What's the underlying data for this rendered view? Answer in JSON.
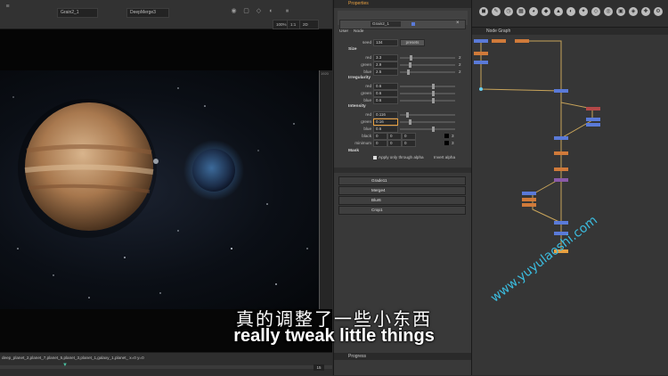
{
  "viewer": {
    "node_field": "Grain2_1",
    "b_field": "DeepMerge3",
    "zoom": "100%",
    "ratio": "1:1",
    "mode": "2D",
    "resolution_tag": "1920",
    "status_text": "deep_planet_2,planet_7,planet_5,planet_3,planet_1,galaxy_1,planet_  x=0 y=0",
    "frame": "15"
  },
  "properties": {
    "tab_title": "Properties",
    "node_name": "Grain2_1",
    "tabs": [
      "User",
      "Node"
    ],
    "seed": {
      "label": "seed",
      "value": "134",
      "presets": "presets"
    },
    "size": {
      "title": "Size",
      "rows": [
        {
          "label": "red",
          "value": "3.3",
          "knob": 0.18,
          "ch": "2"
        },
        {
          "label": "green",
          "value": "2.9",
          "knob": 0.16,
          "ch": "2"
        },
        {
          "label": "blue",
          "value": "2.5",
          "knob": 0.14,
          "ch": "2"
        }
      ]
    },
    "irregularity": {
      "title": "Irregularity",
      "rows": [
        {
          "label": "red",
          "value": "0.6",
          "knob": 0.6
        },
        {
          "label": "green",
          "value": "0.6",
          "knob": 0.6
        },
        {
          "label": "blue",
          "value": "0.6",
          "knob": 0.6
        }
      ]
    },
    "intensity": {
      "title": "Intensity",
      "rows": [
        {
          "label": "red",
          "value": "0.116",
          "knob": 0.12
        },
        {
          "label": "green",
          "value": "0.16",
          "knob": 0.16
        },
        {
          "label": "blue",
          "value": "0.6",
          "knob": 0.6
        }
      ]
    },
    "black": {
      "label": "black",
      "values": [
        "0",
        "0",
        "0"
      ],
      "count": "3"
    },
    "minimum": {
      "label": "minimum",
      "values": [
        "0",
        "0",
        "0"
      ],
      "count": "3"
    },
    "mask": {
      "title": "Mask",
      "apply_label": "Apply only through alpha",
      "invert_label": "Invert alpha"
    },
    "nodes": [
      "Grade11",
      "Merge4",
      "Blur6",
      "Crop1"
    ],
    "progress_label": "Progress"
  },
  "node_graph": {
    "tab_title": "Node Graph"
  },
  "subtitles": {
    "cn": "真的调整了一些小东西",
    "en": "really tweak little things"
  },
  "watermark": "www.yuyulaoshi.com",
  "colors": {
    "accent": "#e8a040",
    "node_blue": "#5a7ad8",
    "node_orange": "#d07a3a",
    "node_red": "#b44848",
    "node_purple": "#8a5aa8"
  }
}
